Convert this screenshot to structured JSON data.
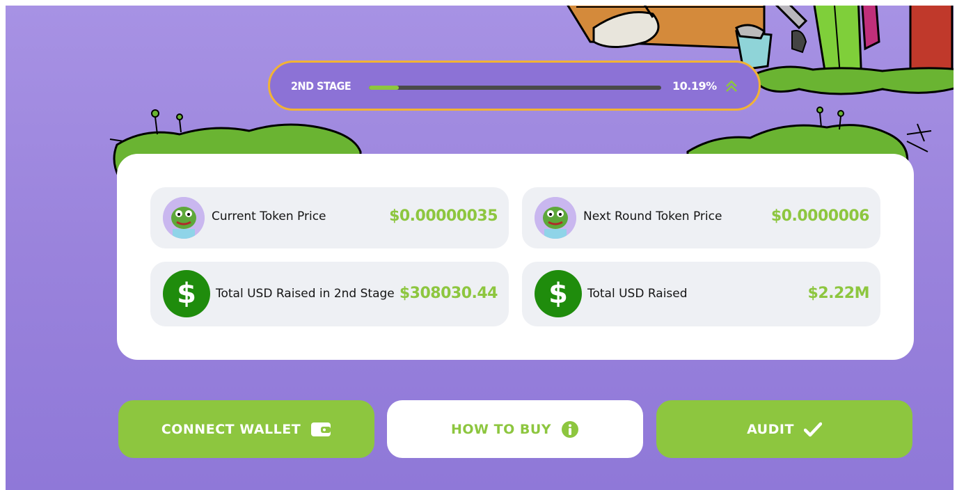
{
  "stage": {
    "label": "2ND STAGE",
    "progress_text": "10.19%",
    "progress_fraction": 0.1019,
    "expand_icon": "double-chevron-up-icon"
  },
  "stats": {
    "current_price": {
      "label": "Current Token Price",
      "value": "$0.00000035",
      "icon": "pepe-avatar-icon"
    },
    "next_price": {
      "label": "Next Round Token Price",
      "value": "$0.0000006",
      "icon": "pepe-avatar-icon"
    },
    "stage_raised": {
      "label": "Total USD Raised in 2nd Stage",
      "value": "$308030.44",
      "icon": "dollar-icon",
      "symbol": "$"
    },
    "total_raised": {
      "label": "Total USD Raised",
      "value": "$2.22M",
      "icon": "dollar-icon",
      "symbol": "$"
    }
  },
  "buttons": {
    "connect_wallet": {
      "label": "CONNECT WALLET",
      "icon": "wallet-icon"
    },
    "how_to_buy": {
      "label": "HOW TO BUY",
      "icon": "info-icon"
    },
    "audit": {
      "label": "AUDIT",
      "icon": "checkmark-icon"
    }
  },
  "colors": {
    "accent_green": "#8dc63f",
    "dollar_green": "#1f8c0c",
    "stage_border": "#f2b334",
    "stage_bg": "#8c72d6",
    "background": "#9a83dc"
  }
}
